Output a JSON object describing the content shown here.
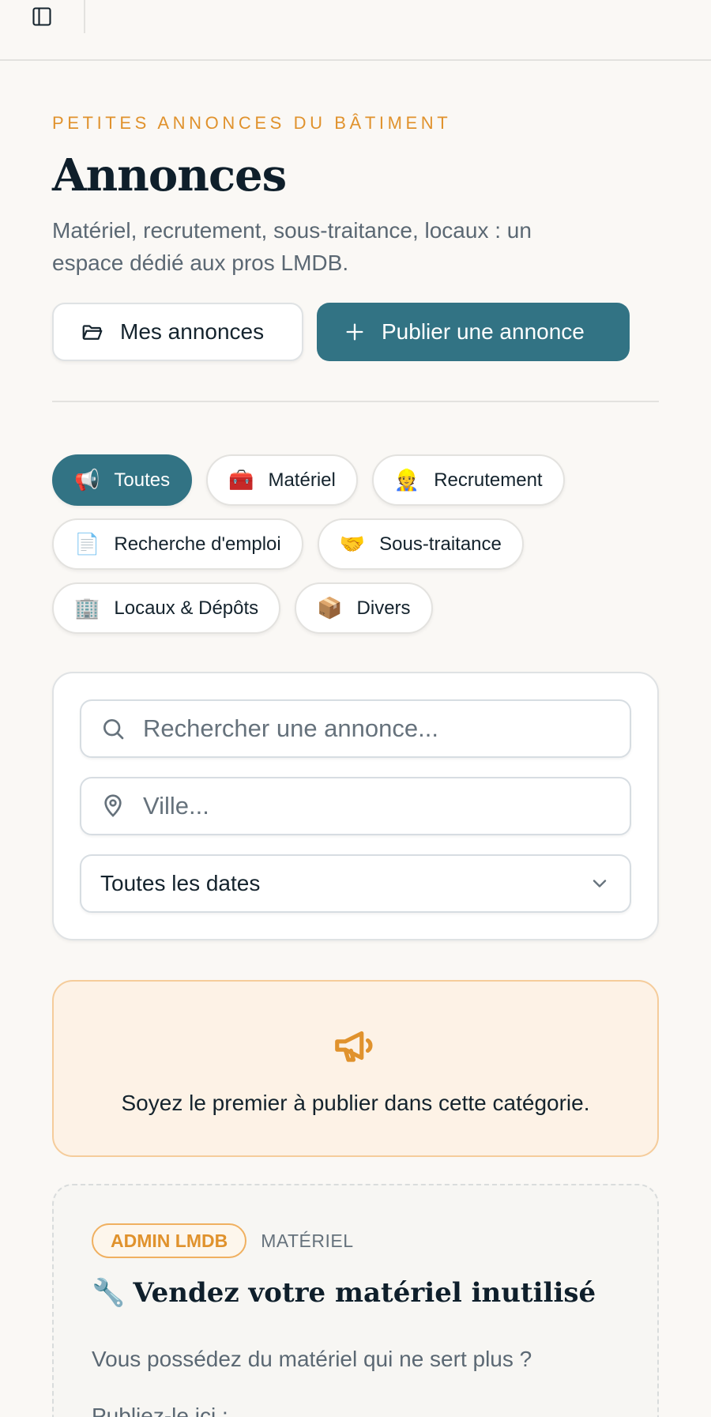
{
  "header": {
    "eyebrow": "PETITES ANNONCES DU BÂTIMENT",
    "title": "Annonces",
    "subtitle": "Matériel, recrutement, sous-traitance, locaux : un espace dédié aux pros LMDB."
  },
  "actions": {
    "my_ads_label": "Mes annonces",
    "publish_label": "Publier une annonce"
  },
  "categories": [
    {
      "emoji": "📢",
      "label": "Toutes",
      "active": true
    },
    {
      "emoji": "🧰",
      "label": "Matériel",
      "active": false
    },
    {
      "emoji": "👷",
      "label": "Recrutement",
      "active": false
    },
    {
      "emoji": "📄",
      "label": "Recherche d'emploi",
      "active": false
    },
    {
      "emoji": "🤝",
      "label": "Sous-traitance",
      "active": false
    },
    {
      "emoji": "🏢",
      "label": "Locaux & Dépôts",
      "active": false
    },
    {
      "emoji": "📦",
      "label": "Divers",
      "active": false
    }
  ],
  "filters": {
    "search_placeholder": "Rechercher une annonce...",
    "city_placeholder": "Ville...",
    "date_selected": "Toutes les dates"
  },
  "empty_state": {
    "message": "Soyez le premier à publier dans cette catégorie."
  },
  "admin_card": {
    "badge": "ADMIN LMDB",
    "category": "MATÉRIEL",
    "emoji": "🔧",
    "title": "Vendez votre matériel inutilisé",
    "body_line1": "Vous possédez du matériel qui ne sert plus ?",
    "body_line2": "Publiez-le ici :"
  },
  "colors": {
    "primary": "#327384",
    "accent": "#e0922d",
    "background": "#faf8f5"
  },
  "icons": {
    "sidebar": "sidebar-icon",
    "folder": "folder-open-icon",
    "plus": "plus-icon",
    "search": "search-icon",
    "location": "map-pin-icon",
    "chevron": "chevron-down-icon",
    "megaphone": "megaphone-icon"
  }
}
